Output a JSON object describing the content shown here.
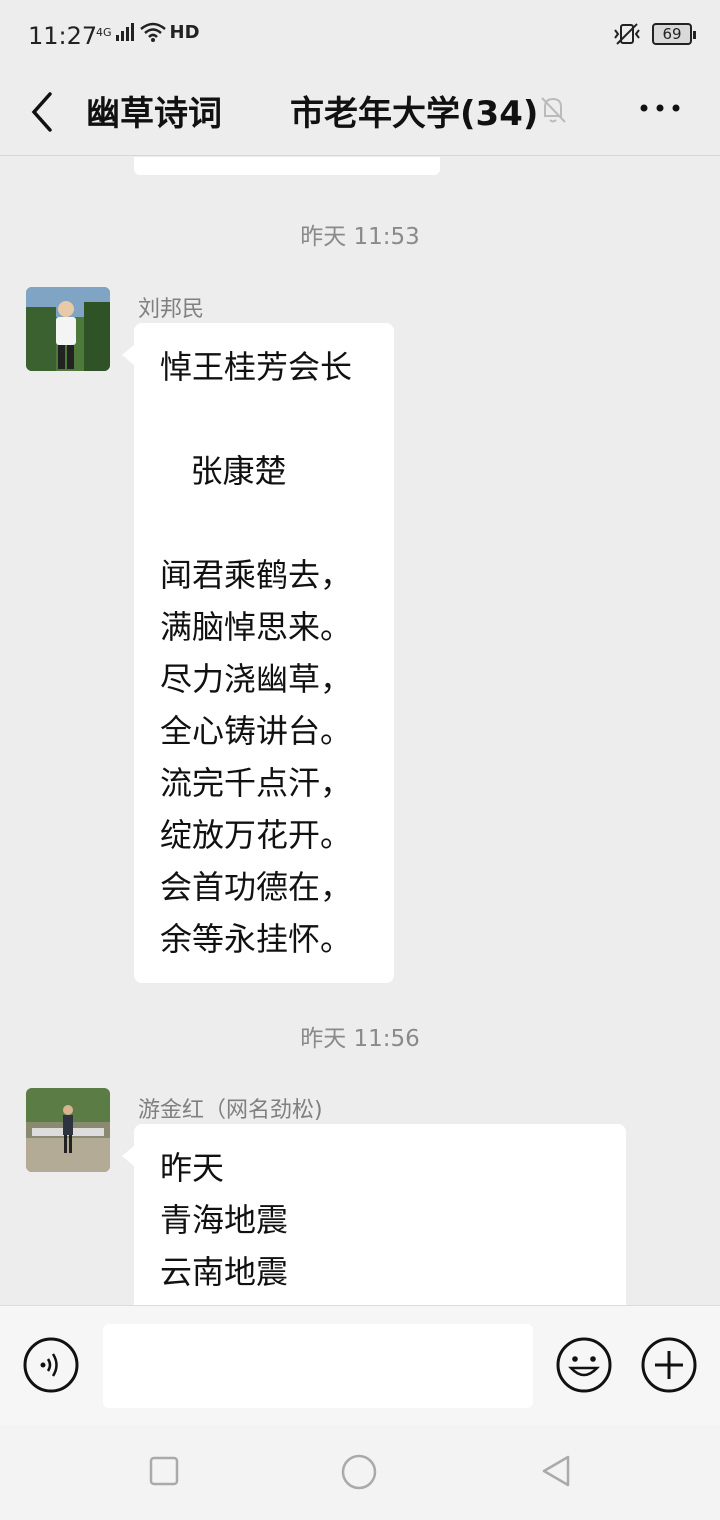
{
  "status_bar": {
    "time": "11:27",
    "network": "4G",
    "hd_label": "HD",
    "battery": "69"
  },
  "header": {
    "group_name": "幽草诗词",
    "title": "市老年大学(34)"
  },
  "messages": [
    {
      "timestamp": "昨天 11:53",
      "sender": "刘邦民",
      "lines": [
        "悼王桂芳会长",
        "",
        "   张康楚",
        "",
        "闻君乘鹤去，",
        "满脑悼思来。",
        "尽力浇幽草，",
        "全心铸讲台。",
        "流完千点汗，",
        "绽放万花开。",
        "会首功德在，",
        "余等永挂怀。"
      ]
    },
    {
      "timestamp": "昨天 11:56",
      "sender": "游金红（网名劲松)",
      "lines": [
        "昨天",
        "青海地震",
        "云南地震"
      ]
    }
  ],
  "input": {
    "placeholder": ""
  },
  "colors": {
    "background": "#ededed",
    "bubble": "#ffffff",
    "meta_text": "#8a8a8a"
  },
  "icons": [
    "back-arrow-icon",
    "mute-bell-icon",
    "more-dots-icon",
    "voice-icon",
    "emoji-icon",
    "plus-icon"
  ]
}
